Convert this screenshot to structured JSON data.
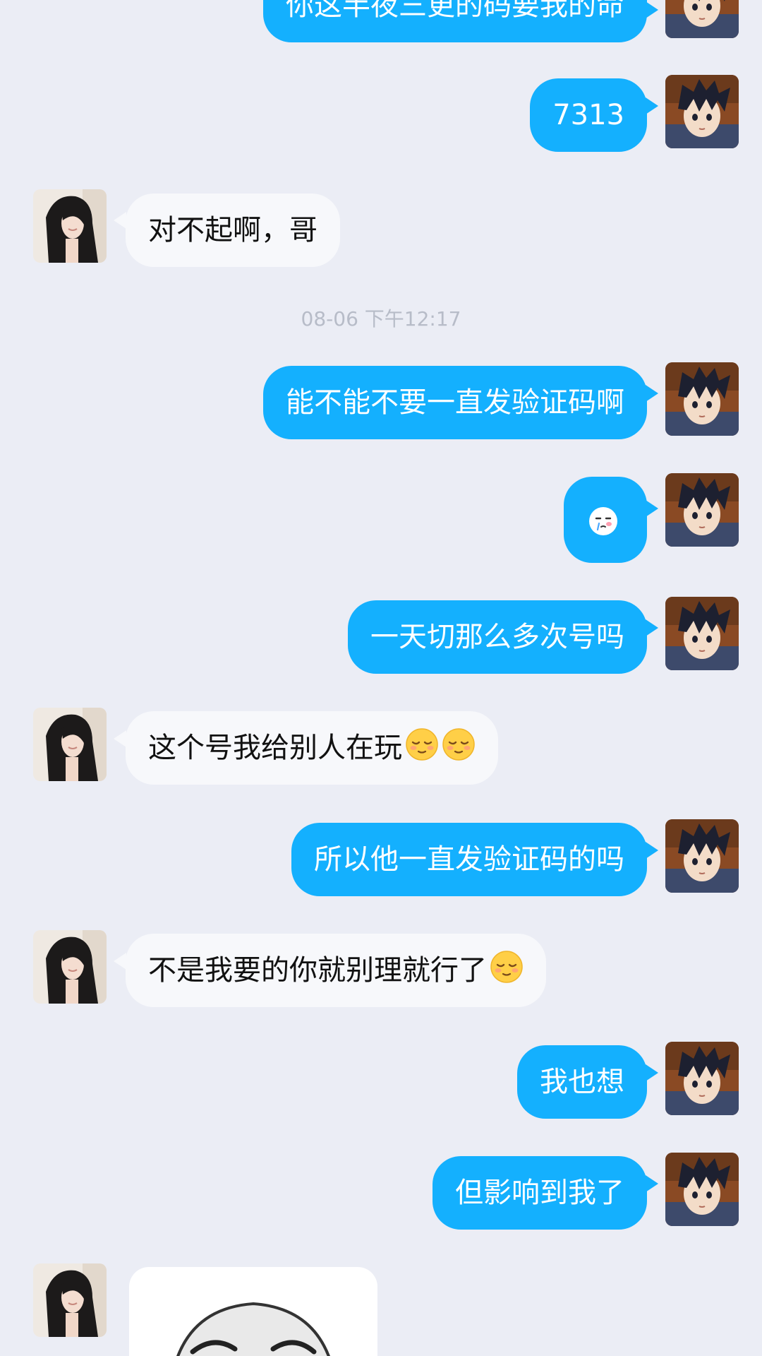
{
  "timestamp": "08-06 下午12:17",
  "messages": [
    {
      "side": "self",
      "text": "你这半夜三更的码要我的命"
    },
    {
      "side": "self",
      "text": "7313"
    },
    {
      "side": "peer",
      "text": "对不起啊，哥"
    },
    {
      "side": "self",
      "text": "能不能不要一直发验证码啊"
    },
    {
      "side": "self",
      "sticker": "crying-face-sticker"
    },
    {
      "side": "self",
      "text": "一天切那么多次号吗"
    },
    {
      "side": "peer",
      "text": "这个号我给别人在玩",
      "emoji": [
        "relieved-face",
        "relieved-face"
      ]
    },
    {
      "side": "self",
      "text": "所以他一直发验证码的吗"
    },
    {
      "side": "peer",
      "text": "不是我要的你就别理就行了",
      "emoji": [
        "relieved-face"
      ]
    },
    {
      "side": "self",
      "text": "我也想"
    },
    {
      "side": "self",
      "text": "但影响到我了"
    },
    {
      "side": "peer",
      "sticker": "panda-face-meme-sticker"
    }
  ],
  "colors": {
    "background": "#ebedf5",
    "self_bubble": "#14b0fe",
    "peer_bubble": "#f7f8fb"
  },
  "avatars": {
    "self": "anime-boy-avatar",
    "peer": "girl-photo-avatar"
  }
}
